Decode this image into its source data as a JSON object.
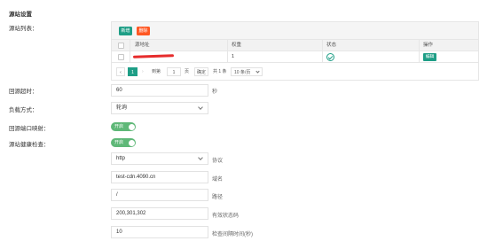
{
  "section_title": "源站设置",
  "source_list": {
    "label": "源站列表：",
    "add_label": "新增",
    "delete_label": "删除",
    "columns": [
      "源地址",
      "权重",
      "状态",
      "操作"
    ],
    "rows": [
      {
        "weight": "1",
        "action_label": "编辑"
      }
    ],
    "pager": {
      "current_page": "1",
      "goto_label": "到第",
      "goto_value": "1",
      "page_unit": "页",
      "confirm_label": "确定",
      "total_label": "共 1 条",
      "per_page_label": "10 条/页"
    }
  },
  "timeout": {
    "label": "回源超时：",
    "value": "60",
    "unit": "秒"
  },
  "load_balance": {
    "label": "负载方式：",
    "value": "轮询"
  },
  "port_mapping": {
    "label": "回源端口映射：",
    "toggle_label": "开启"
  },
  "health_check": {
    "label": "源站健康检查：",
    "toggle_label": "开启",
    "protocol": {
      "value": "http",
      "label": "协议"
    },
    "domain": {
      "value": "test-cdn.4090.cn",
      "label": "域名"
    },
    "path": {
      "value": "/",
      "label": "路径"
    },
    "status_codes": {
      "value": "200,301,302",
      "label": "有效状态码"
    },
    "interval": {
      "value": "10",
      "label": "检查间隔时间(秒)"
    }
  }
}
